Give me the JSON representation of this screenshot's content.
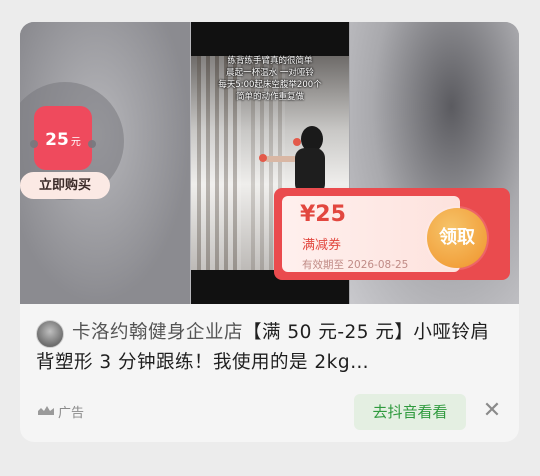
{
  "video": {
    "caption_lines": [
      "练背练手臂真的很简单",
      "晨起一杯温水 一对哑铃",
      "每天5:00起床空腹举200个",
      "简单的动作重复做"
    ]
  },
  "left_badge": {
    "amount": "25",
    "unit": "元",
    "buy_label": "立即购买"
  },
  "coupon": {
    "amount": "¥25",
    "type": "满减券",
    "expiry": "有效期至 2026-08-25",
    "claim_label": "领取",
    "color": "#ea4b4e",
    "claim_color": "#f2a23e"
  },
  "post": {
    "shop_name": "卡洛约翰健身企业店",
    "title_rest": "【满 50 元-25 元】小哑铃肩背塑形 3 分钟跟练！我使用的是 2kg…"
  },
  "footer": {
    "ad_icon": "ad-wave-icon",
    "ad_label": "广告",
    "open_label": "去抖音看看",
    "close_icon": "close-icon",
    "open_color": "#2f9a3e"
  }
}
